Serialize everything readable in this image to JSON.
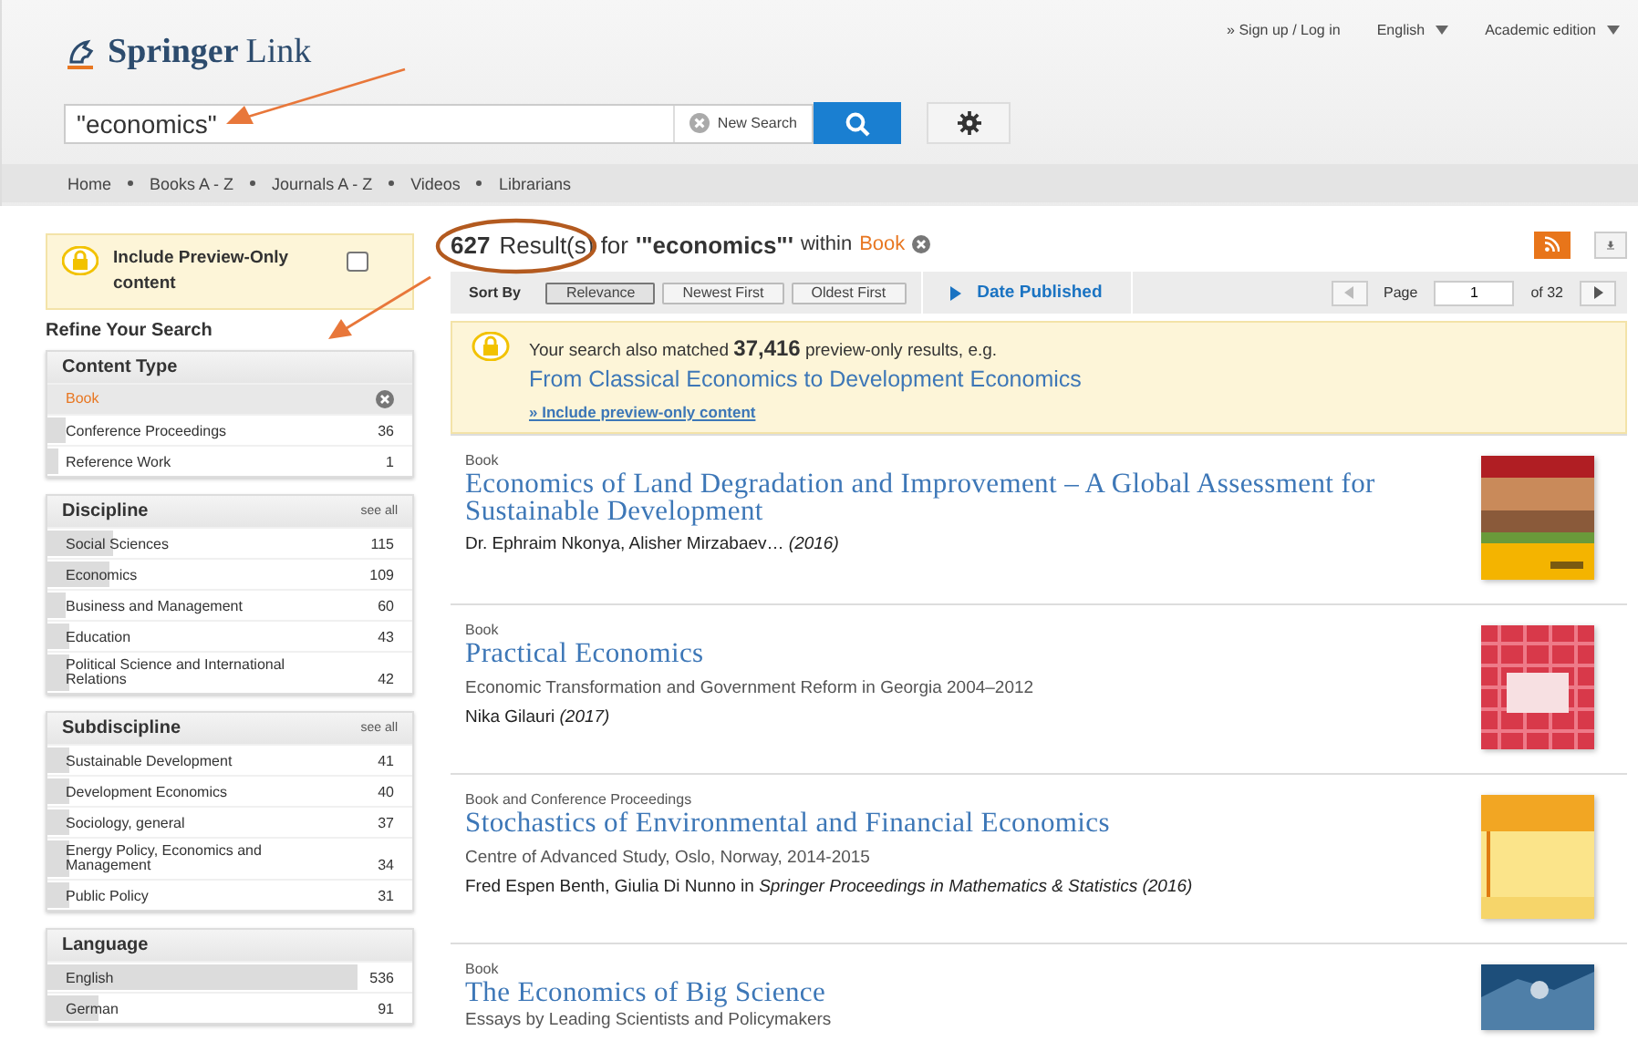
{
  "header": {
    "logo": {
      "brand": "Springer",
      "product": "Link"
    },
    "top_links": [
      {
        "label": "» Sign up / Log in",
        "kind": "link"
      },
      {
        "label": "English",
        "kind": "dropdown"
      },
      {
        "label": "Academic edition",
        "kind": "dropdown"
      }
    ],
    "search": {
      "value": "\"economics\"",
      "clear_label": "New Search"
    },
    "nav": [
      "Home",
      "Books A - Z",
      "Journals A - Z",
      "Videos",
      "Librarians"
    ]
  },
  "sidebar": {
    "preview_toggle": {
      "label": "Include Preview-Only content",
      "checked": false
    },
    "heading": "Refine Your Search",
    "facets": [
      {
        "title": "Content Type",
        "items": [
          {
            "label": "Book",
            "selected": true
          },
          {
            "label": "Conference Proceedings",
            "count": "36",
            "selected": false,
            "level": 0.05
          },
          {
            "label": "Reference Work",
            "count": "1",
            "selected": false,
            "level": 0.03
          }
        ]
      },
      {
        "title": "Discipline",
        "see_all": "see all",
        "items": [
          {
            "label": "Social Sciences",
            "count": "115",
            "selected": false,
            "level": 0.18
          },
          {
            "label": "Economics",
            "count": "109",
            "selected": false,
            "level": 0.17
          },
          {
            "label": "Business and Management",
            "count": "60",
            "selected": false,
            "level": 0.05
          },
          {
            "label": "Education",
            "count": "43",
            "selected": false,
            "level": 0.06
          },
          {
            "label": "Political Science and International Relations",
            "count": "42",
            "selected": false,
            "level": 0.06
          }
        ]
      },
      {
        "title": "Subdiscipline",
        "see_all": "see all",
        "items": [
          {
            "label": "Sustainable Development",
            "count": "41",
            "selected": false,
            "level": 0.06
          },
          {
            "label": "Development Economics",
            "count": "40",
            "selected": false,
            "level": 0.06
          },
          {
            "label": "Sociology, general",
            "count": "37",
            "selected": false,
            "level": 0.06
          },
          {
            "label": "Energy Policy, Economics and Management",
            "count": "34",
            "selected": false,
            "level": 0.06
          },
          {
            "label": "Public Policy",
            "count": "31",
            "selected": false,
            "level": 0.06
          }
        ]
      },
      {
        "title": "Language",
        "items": [
          {
            "label": "English",
            "count": "536",
            "selected": false,
            "level": 0.85
          },
          {
            "label": "German",
            "count": "91",
            "selected": false,
            "level": 0.14
          }
        ]
      }
    ]
  },
  "summary": {
    "count": "627",
    "label": "Result(s) for",
    "query": "'\"economics\"'",
    "within": "within",
    "filter": "Book"
  },
  "sort": {
    "label": "Sort By",
    "options": [
      {
        "label": "Relevance",
        "selected": true
      },
      {
        "label": "Newest First",
        "selected": false
      },
      {
        "label": "Oldest First",
        "selected": false
      }
    ],
    "date_filter": "Date Published"
  },
  "pager": {
    "label": "Page",
    "value": "1",
    "total": "of 32"
  },
  "notice": {
    "text": "Your search also matched **37,416** preview-only results, e.g.",
    "example": "From Classical Economics to Development Economics",
    "link": "» Include preview-only content"
  },
  "results": [
    {
      "type": "Book",
      "title": "Economics of Land Degradation and Improvement – A Global Assessment for Sustainable Development",
      "byline": "Dr. Ephraim Nkonya, Alisher Mirzabaev… *(2016)*"
    },
    {
      "type": "Book",
      "title": "Practical Economics",
      "subtitle": "Economic Transformation and Government Reform in Georgia 2004–2012",
      "byline": "Nika Gilauri *(2017)*"
    },
    {
      "type": "Book and Conference Proceedings",
      "title": "Stochastics of Environmental and Financial Economics",
      "subtitle": "Centre of Advanced Study, Oslo, Norway, 2014-2015",
      "byline": "Fred Espen Benth, Giulia Di Nunno in *Springer Proceedings in Mathematics & Statistics (2016)*"
    },
    {
      "type": "Book",
      "title": "The Economics of Big Science",
      "subtitle": "Essays by Leading Scientists and Policymakers"
    }
  ],
  "annotations": [
    {
      "kind": "arrow"
    },
    {
      "kind": "arrow"
    },
    {
      "kind": "ellipse"
    }
  ]
}
